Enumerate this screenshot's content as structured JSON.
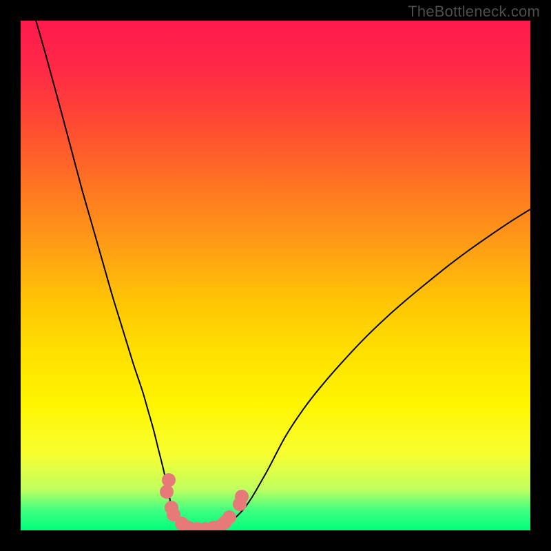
{
  "watermark": "TheBottleneck.com",
  "chart_data": {
    "type": "line",
    "title": "",
    "xlabel": "",
    "ylabel": "",
    "xlim": [
      0,
      100
    ],
    "ylim": [
      0,
      100
    ],
    "grid": false,
    "legend": false,
    "gradient_meaning": "vertical color scale (red = high bottleneck, green = low bottleneck)",
    "x": [
      3,
      5,
      8,
      10,
      12,
      14,
      16,
      18,
      20,
      22,
      23,
      24,
      25,
      26,
      27,
      28,
      29,
      30,
      32,
      34,
      36,
      40,
      44,
      48,
      52,
      56,
      60,
      64,
      68,
      72,
      76,
      80,
      84,
      88,
      92,
      96,
      100
    ],
    "y": [
      100,
      93,
      82,
      74.5,
      67,
      60,
      53,
      46,
      39.5,
      33,
      30,
      27,
      23.5,
      20,
      16,
      12,
      7.5,
      3.3,
      1.2,
      0.3,
      0.3,
      1,
      4.5,
      11,
      18.5,
      24.5,
      29.5,
      34,
      38.2,
      42,
      45.5,
      48.8,
      52,
      55,
      57.8,
      60.5,
      63
    ],
    "markers": [
      {
        "name": "left-upper-pair",
        "x": 28.7,
        "y": 7.6
      },
      {
        "name": "left-upper-pair",
        "x": 29.0,
        "y": 9.8
      },
      {
        "name": "left-lower-pair",
        "x": 29.6,
        "y": 4.5
      },
      {
        "name": "left-lower-pair",
        "x": 30.0,
        "y": 3.1
      },
      {
        "name": "bottom-cluster",
        "x": 31.6,
        "y": 1.4
      },
      {
        "name": "bottom-cluster",
        "x": 33.0,
        "y": 0.6
      },
      {
        "name": "bottom-cluster",
        "x": 34.6,
        "y": 0.3
      },
      {
        "name": "bottom-cluster",
        "x": 36.2,
        "y": 0.3
      },
      {
        "name": "bottom-cluster",
        "x": 37.8,
        "y": 0.5
      },
      {
        "name": "bottom-cluster",
        "x": 39.2,
        "y": 0.8
      },
      {
        "name": "right-lower-pair",
        "x": 40.2,
        "y": 1.6
      },
      {
        "name": "right-lower-pair",
        "x": 41.0,
        "y": 2.6
      },
      {
        "name": "right-upper-pair",
        "x": 43.0,
        "y": 5.2
      },
      {
        "name": "right-upper-pair",
        "x": 43.4,
        "y": 6.6
      }
    ]
  }
}
